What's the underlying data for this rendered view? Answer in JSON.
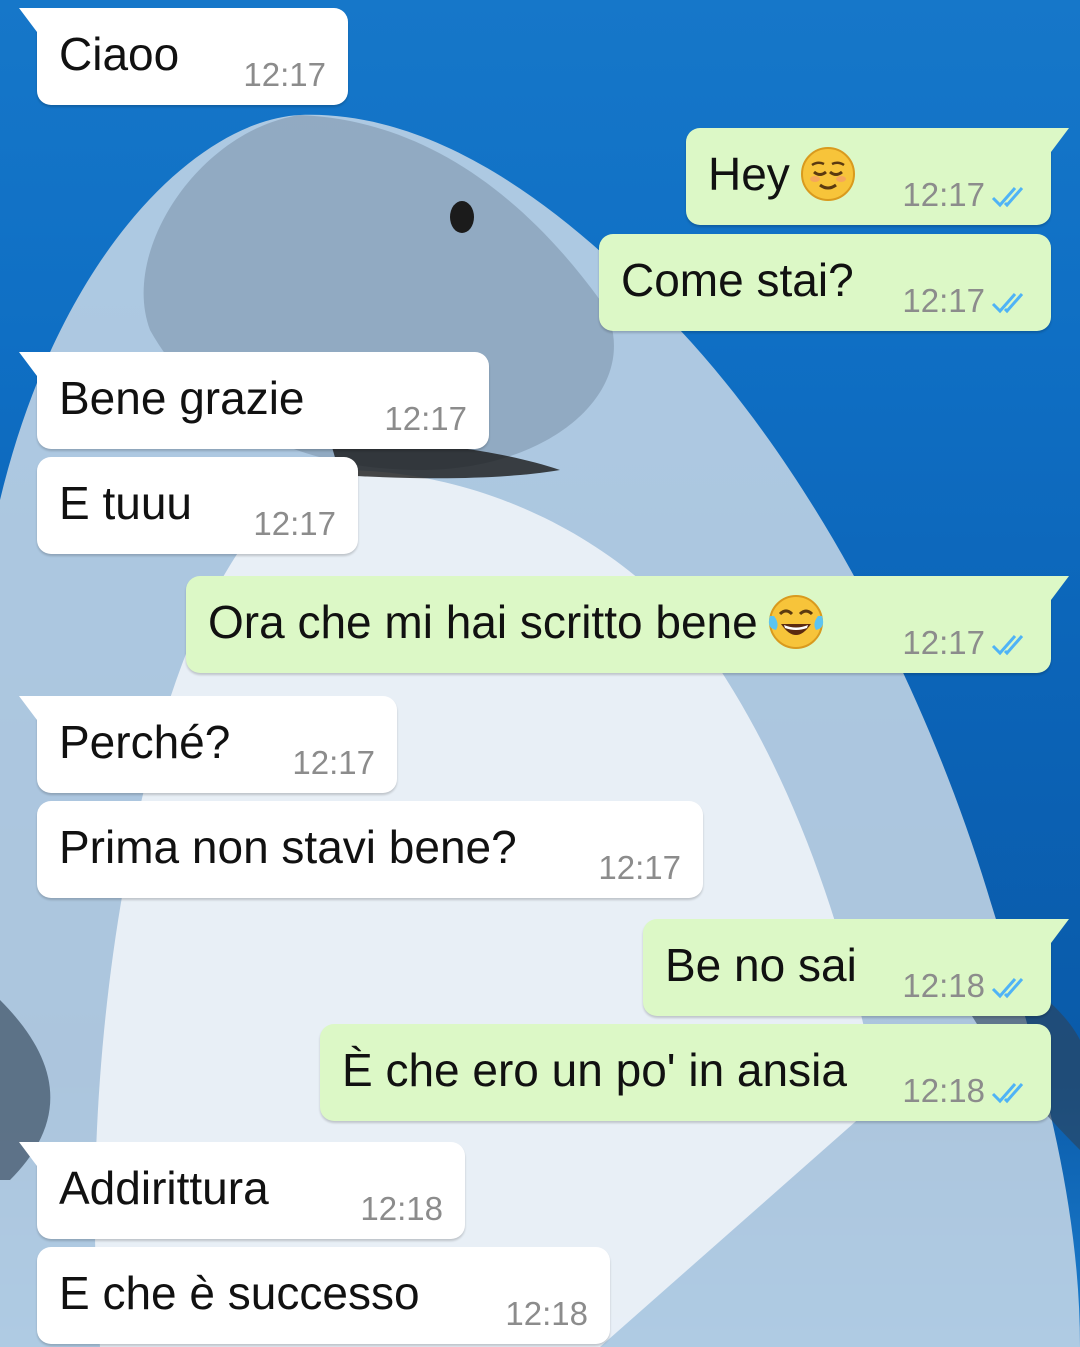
{
  "messages": [
    {
      "dir": "in",
      "tail": true,
      "text": "Ciaoo",
      "time": "12:17"
    },
    {
      "dir": "out",
      "tail": true,
      "text": "Hey",
      "emoji": "relieved-face",
      "time": "12:17",
      "ticks": "double-check-read"
    },
    {
      "dir": "out",
      "tail": false,
      "text": "Come stai?",
      "time": "12:17",
      "ticks": "double-check-read"
    },
    {
      "dir": "in",
      "tail": true,
      "text": "Bene grazie",
      "time": "12:17"
    },
    {
      "dir": "in",
      "tail": false,
      "text": "E tuuu",
      "time": "12:17"
    },
    {
      "dir": "out",
      "tail": true,
      "text": "Ora che mi hai scritto bene",
      "emoji": "face-with-tears-of-joy",
      "time": "12:17",
      "ticks": "double-check-read"
    },
    {
      "dir": "in",
      "tail": true,
      "text": "Perché?",
      "time": "12:17"
    },
    {
      "dir": "in",
      "tail": false,
      "text": "Prima non stavi bene?",
      "time": "12:17"
    },
    {
      "dir": "out",
      "tail": true,
      "text": "Be no sai",
      "time": "12:18",
      "ticks": "double-check-read"
    },
    {
      "dir": "out",
      "tail": false,
      "text": "È che ero un po' in ansia",
      "time": "12:18",
      "ticks": "double-check-read"
    },
    {
      "dir": "in",
      "tail": true,
      "text": "Addirittura",
      "time": "12:18"
    },
    {
      "dir": "in",
      "tail": false,
      "text": "E che è successo",
      "time": "12:18"
    }
  ],
  "colors": {
    "incoming_bubble": "#ffffff",
    "outgoing_bubble": "#dcf8c6",
    "read_ticks": "#4fb3f6",
    "timestamp": "#8c8c8c"
  },
  "wallpaper": "shark-underwater"
}
